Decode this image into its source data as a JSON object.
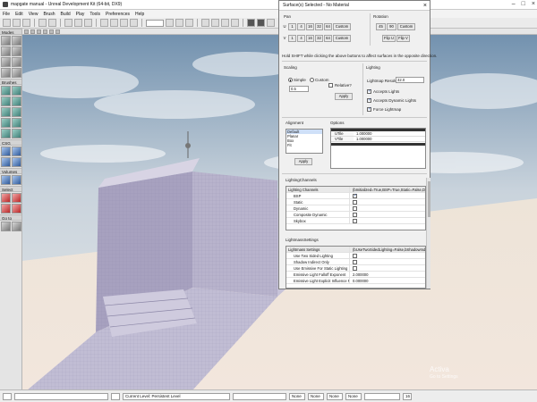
{
  "window": {
    "title": "mapgate manual - Unreal Development Kit (64-bit, DX9)"
  },
  "menu": [
    "File",
    "Edit",
    "View",
    "Brush",
    "Build",
    "Play",
    "Tools",
    "Preferences",
    "Help"
  ],
  "tools": {
    "modes": "Modes",
    "brushes": "Brushes",
    "csg": "CSG",
    "volumes": "Volumes",
    "select": "Select",
    "goto": "Go to"
  },
  "dialog": {
    "title": "Surface(s) Selected - No Material",
    "pan_label": "Pan",
    "rotation_label": "Rotation",
    "pan_u_label": "U",
    "pan_v_label": "V",
    "pan_buttons": [
      "1",
      "4",
      "16",
      "32",
      "64",
      "Custom"
    ],
    "rotation_buttons": [
      "45",
      "90",
      "Custom"
    ],
    "flip_u": "Flip U",
    "flip_v": "Flip V",
    "hint": "Hold SHIFT while clicking the above buttons to affect surfaces in the opposite direction.",
    "scaling_label": "Scaling",
    "simple": "Simple",
    "custom": "Custom",
    "scale_value": "0.5",
    "relative": "Relative?",
    "apply": "Apply",
    "lighting_label": "Lighting",
    "lightmap_res_label": "Lightmap Resolution",
    "lightmap_res_value": "32.0",
    "accepts_lights": "Accepts Lights",
    "accepts_dynamic_lights": "Accepts Dynamic Lights",
    "force_lightmap": "Force Lightmap",
    "alignment_label": "Alignment",
    "alignment_items": [
      "Default",
      "Planar",
      "Box",
      "Fit"
    ],
    "alignment_apply": "Apply",
    "options_label": "Options",
    "options_rows": [
      {
        "key": "UTile",
        "value": "1.000000"
      },
      {
        "key": "VTile",
        "value": "1.000000"
      }
    ],
    "lighting_channels_label": "LightingChannels",
    "lighting_channels_head": "Lighting Channels",
    "lighting_channels_summary": "(bInitialized=True,BSP=True,Static=False,Dynamic...",
    "channels": [
      {
        "name": "BSP",
        "checked": true
      },
      {
        "name": "Static",
        "checked": false
      },
      {
        "name": "Dynamic",
        "checked": false
      },
      {
        "name": "Composite Dynamic",
        "checked": false
      },
      {
        "name": "Skybox",
        "checked": false
      }
    ],
    "lightmass_label": "LightmassSettings",
    "lightmass_head": "Lightmass Settings",
    "lightmass_summary": "(bUseTwoSidedLighting=False,bShadowIndirect...",
    "lightmass_rows": [
      {
        "name": "Use Two Sided Lighting",
        "value": ""
      },
      {
        "name": "Shadow Indirect Only",
        "value": ""
      },
      {
        "name": "Use Emissive For Static Lighting",
        "value": ""
      },
      {
        "name": "Emissive Light Falloff Exponent",
        "value": "2.000000"
      },
      {
        "name": "Emissive Light Explicit Influence Radius",
        "value": "0.000000"
      }
    ]
  },
  "watermark": {
    "line1": "Activa",
    "line2": "Go to Settings"
  },
  "status": {
    "current_level": "Current Level: Persistent Level",
    "slots": [
      "None",
      "None",
      "None",
      "None"
    ],
    "snap": "16"
  }
}
